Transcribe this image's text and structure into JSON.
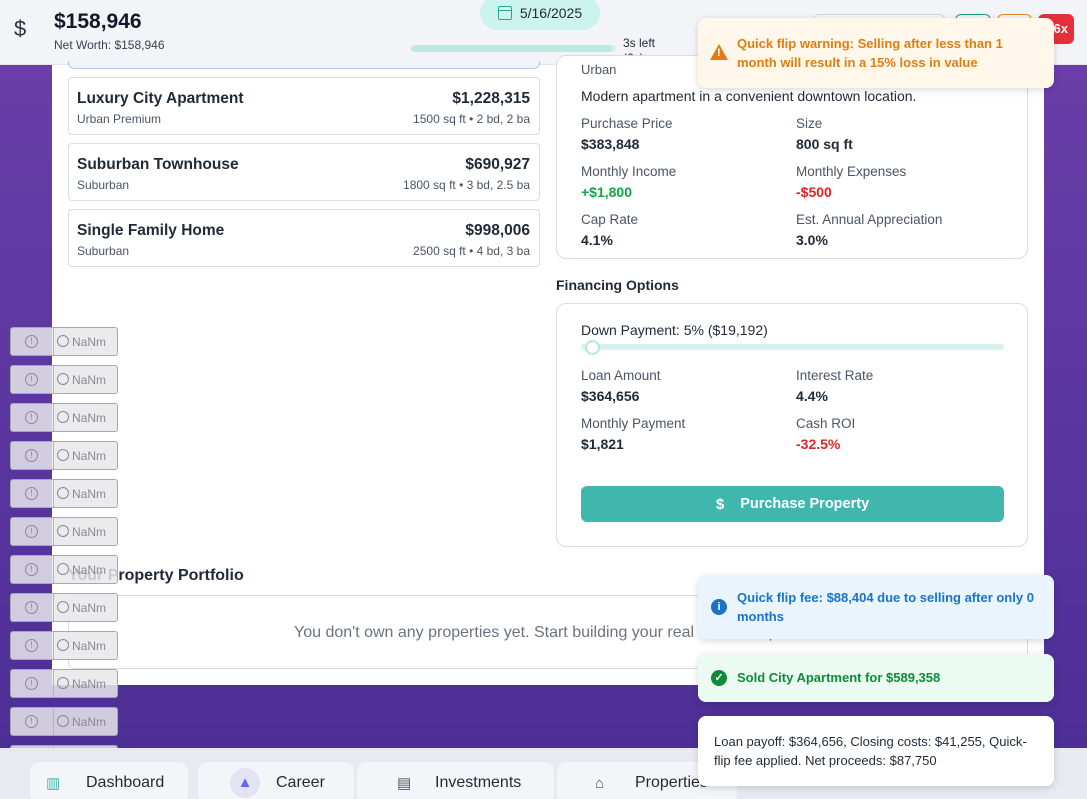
{
  "header": {
    "balance": "$158,946",
    "net_worth": "Net Worth: $158,946",
    "date": "5/16/2025",
    "time_left": "3s left",
    "speed": "(6x)",
    "day_progress": 0.98,
    "close_label": "6x"
  },
  "property_list": [
    {
      "name": "Luxury City Apartment",
      "type": "Urban Premium",
      "price": "$1,228,315",
      "specs": "1500 sq ft • 2 bd, 2 ba"
    },
    {
      "name": "Suburban Townhouse",
      "type": "Suburban",
      "price": "$690,927",
      "specs": "1800 sq ft • 3 bd, 2.5 ba"
    },
    {
      "name": "Single Family Home",
      "type": "Suburban",
      "price": "$998,006",
      "specs": "2500 sq ft • 4 bd, 3 ba"
    }
  ],
  "details": {
    "category": "Urban",
    "description": "Modern apartment in a convenient downtown location.",
    "stats": [
      {
        "label": "Purchase Price",
        "value": "$383,848"
      },
      {
        "label": "Size",
        "value": "800 sq ft"
      },
      {
        "label": "Monthly Income",
        "value": "+$1,800"
      },
      {
        "label": "Monthly Expenses",
        "value": "-$500"
      },
      {
        "label": "Cap Rate",
        "value": "4.1%"
      },
      {
        "label": "Est. Annual Appreciation",
        "value": "3.0%"
      }
    ]
  },
  "financing": {
    "title": "Financing Options",
    "down_payment_label": "Down Payment: 5% ($19,192)",
    "down_payment_fraction": 0.05,
    "stats": [
      {
        "label": "Loan Amount",
        "value": "$364,656"
      },
      {
        "label": "Interest Rate",
        "value": "4.4%"
      },
      {
        "label": "Monthly Payment",
        "value": "$1,821"
      },
      {
        "label": "Cash ROI",
        "value": "-32.5%"
      }
    ],
    "purchase_label": "Purchase Property"
  },
  "portfolio": {
    "title": "Your Property Portfolio",
    "empty_text": "You don't own any properties yet. Start building your real estate empire!"
  },
  "chips": {
    "label": "NaNm",
    "count": 13
  },
  "bottom_nav": [
    {
      "label": "Dashboard",
      "icon": "building-icon"
    },
    {
      "label": "Career",
      "icon": "graduation-cap-icon"
    },
    {
      "label": "Investments",
      "icon": "bar-chart-icon"
    },
    {
      "label": "Properties",
      "icon": "home-icon"
    }
  ],
  "toasts": {
    "warning": "Quick flip warning: Selling after less than 1 month will result in a 15% loss in value",
    "info": "Quick flip fee: $88,404 due to selling after only 0 months",
    "success": "Sold City Apartment for $589,358",
    "plain": "Loan payoff: $364,656, Closing costs: $41,255, Quick-flip fee applied. Net proceeds: $87,750"
  },
  "colors": {
    "accent": "#3fb7ad",
    "positive": "#16a34a",
    "negative": "#dc2626",
    "background_purple": "#5a35a0"
  }
}
